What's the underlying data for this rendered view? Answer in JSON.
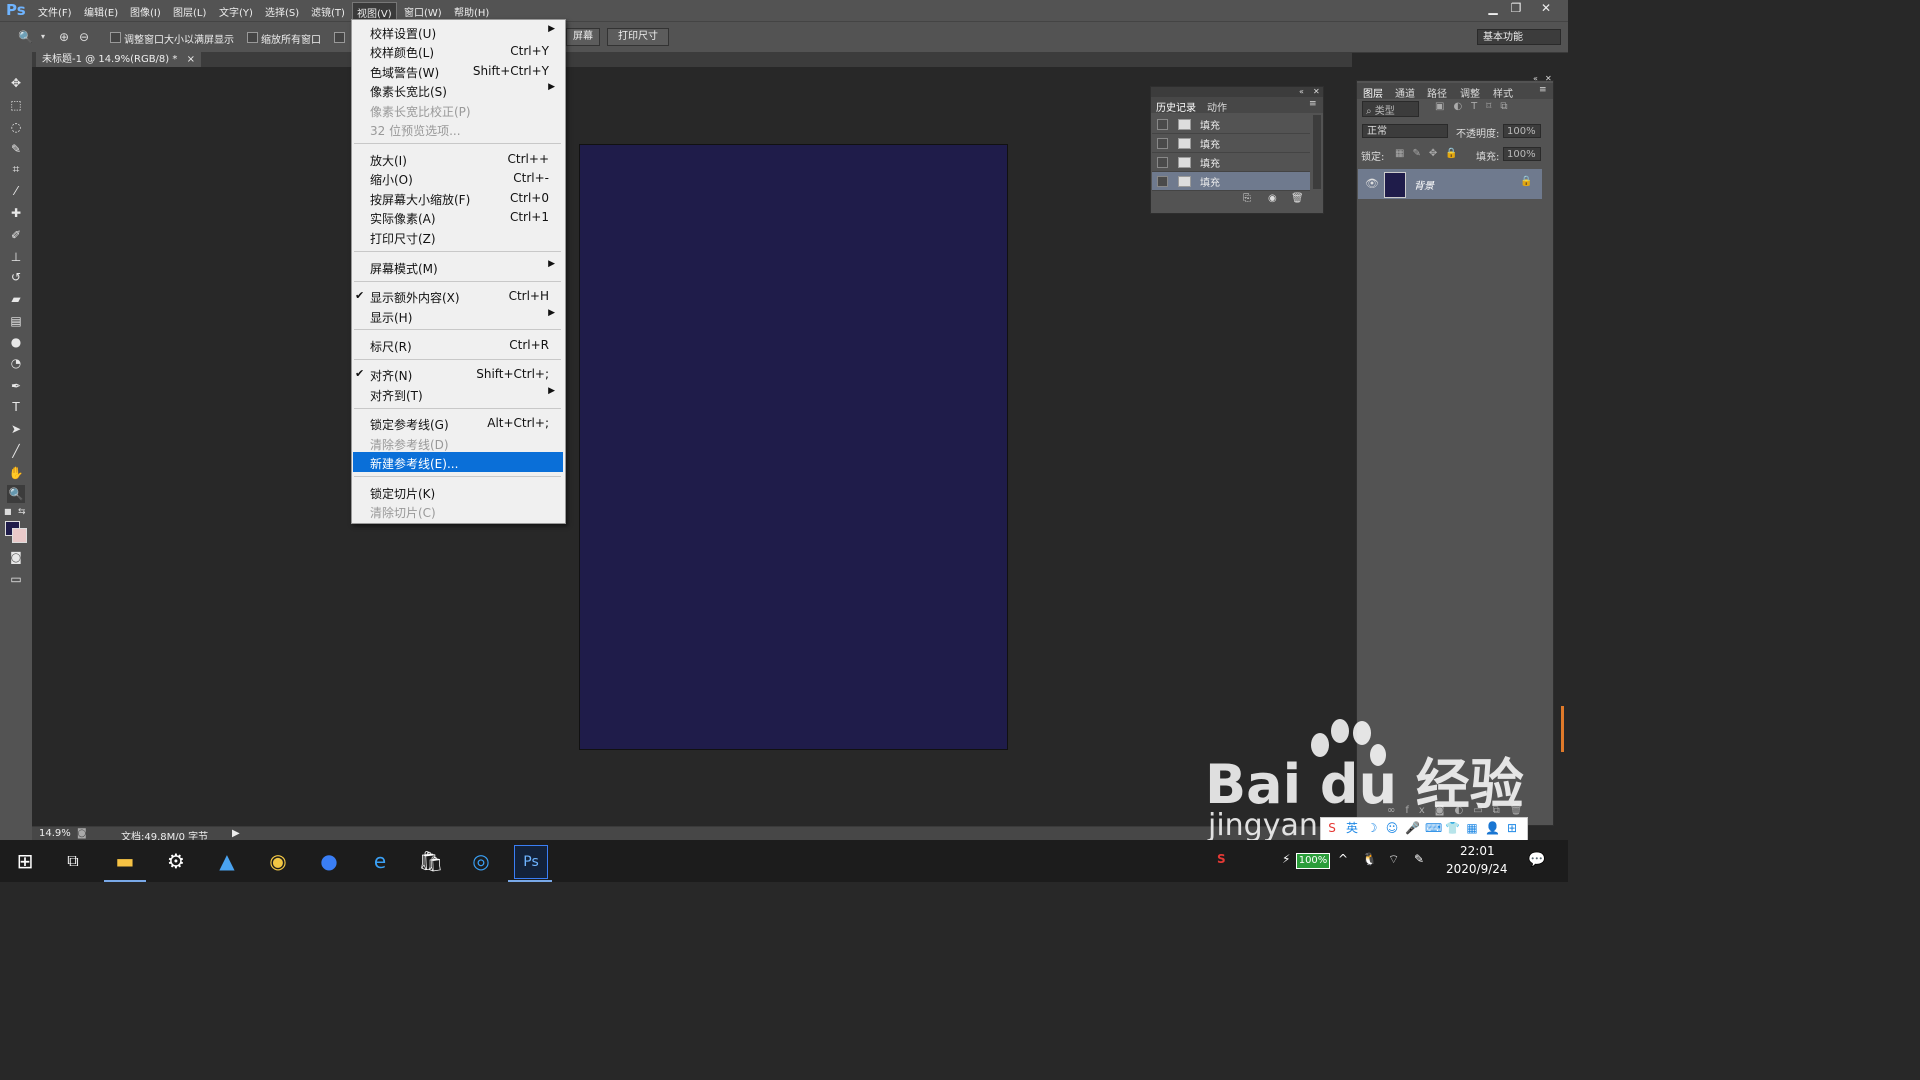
{
  "app": {
    "logo": "Ps"
  },
  "menubar": {
    "items": [
      "文件(F)",
      "编辑(E)",
      "图像(I)",
      "图层(L)",
      "文字(Y)",
      "选择(S)",
      "滤镜(T)",
      "视图(V)",
      "窗口(W)",
      "帮助(H)"
    ],
    "active": "视图(V)"
  },
  "window_controls": {
    "minimize": "▁",
    "restore": "❐",
    "close": "✕"
  },
  "options": {
    "resize_windows": "调整窗口大小以满屏显示",
    "zoom_all": "缩放所有窗口",
    "fill_screen": "屏幕",
    "print_size": "打印尺寸",
    "workspace": "基本功能"
  },
  "doc_tab": {
    "title": "未标题-1 @ 14.9%(RGB/8) *",
    "close": "×"
  },
  "status": {
    "zoom": "14.9%",
    "doc_info": "文档:49.8M/0 字节"
  },
  "history_panel": {
    "tabs": [
      "历史记录",
      "动作"
    ],
    "rows": [
      "填充",
      "填充",
      "填充",
      "填充"
    ],
    "selected_index": 3
  },
  "layers_panel": {
    "tabs": [
      "图层",
      "通道",
      "路径",
      "调整",
      "样式"
    ],
    "kind_filter": "类型",
    "blend_mode": "正常",
    "opacity_label": "不透明度:",
    "opacity_value": "100%",
    "lock_label": "锁定:",
    "fill_label": "填充:",
    "fill_value": "100%",
    "layer_name": "背景"
  },
  "view_menu": {
    "items": [
      {
        "label": "校样设置(U)",
        "submenu": true
      },
      {
        "label": "校样颜色(L)",
        "shortcut": "Ctrl+Y"
      },
      {
        "label": "色域警告(W)",
        "shortcut": "Shift+Ctrl+Y"
      },
      {
        "label": "像素长宽比(S)",
        "submenu": true
      },
      {
        "label": "像素长宽比校正(P)",
        "disabled": true
      },
      {
        "label": "32 位预览选项...",
        "disabled": true
      },
      {
        "label": "放大(I)",
        "shortcut": "Ctrl++"
      },
      {
        "label": "缩小(O)",
        "shortcut": "Ctrl+-"
      },
      {
        "label": "按屏幕大小缩放(F)",
        "shortcut": "Ctrl+0"
      },
      {
        "label": "实际像素(A)",
        "shortcut": "Ctrl+1"
      },
      {
        "label": "打印尺寸(Z)"
      },
      {
        "label": "屏幕模式(M)",
        "submenu": true
      },
      {
        "label": "显示额外内容(X)",
        "shortcut": "Ctrl+H",
        "checked": true
      },
      {
        "label": "显示(H)",
        "submenu": true
      },
      {
        "label": "标尺(R)",
        "shortcut": "Ctrl+R"
      },
      {
        "label": "对齐(N)",
        "shortcut": "Shift+Ctrl+;",
        "checked": true
      },
      {
        "label": "对齐到(T)",
        "submenu": true
      },
      {
        "label": "锁定参考线(G)",
        "shortcut": "Alt+Ctrl+;"
      },
      {
        "label": "清除参考线(D)",
        "disabled": true
      },
      {
        "label": "新建参考线(E)...",
        "highlighted": true
      },
      {
        "label": "锁定切片(K)"
      },
      {
        "label": "清除切片(C)",
        "disabled": true
      }
    ]
  },
  "watermark": {
    "brand": "Bai du 经验",
    "url": "jingyan"
  },
  "taskbar": {
    "battery": "100%",
    "time": "22:01",
    "date": "2020/9/24",
    "ps_label": "Ps"
  },
  "colors": {
    "document_fill": "#1f1c4a",
    "menu_highlight": "#0a6fd8",
    "foreground": "#1f1c4a",
    "background": "#e9c9c9"
  }
}
